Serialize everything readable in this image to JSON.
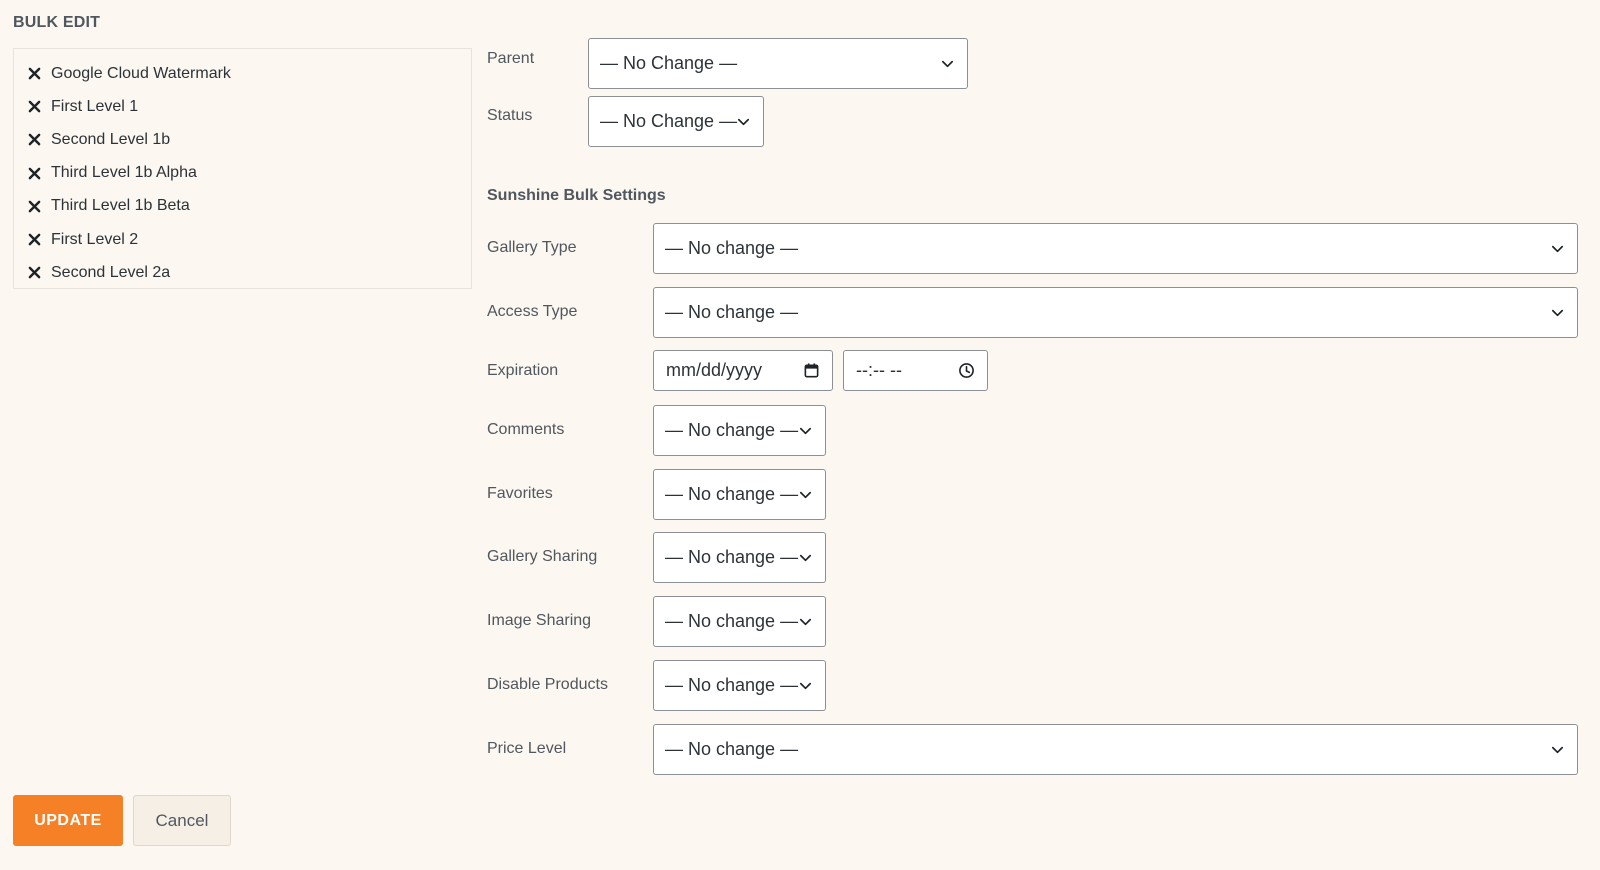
{
  "title": "BULK EDIT",
  "items": [
    {
      "label": "Google Cloud Watermark"
    },
    {
      "label": "First Level 1"
    },
    {
      "label": "Second Level 1b"
    },
    {
      "label": "Third Level 1b Alpha"
    },
    {
      "label": "Third Level 1b Beta"
    },
    {
      "label": "First Level 2"
    },
    {
      "label": "Second Level 2a"
    }
  ],
  "fields": {
    "parent": {
      "label": "Parent",
      "value": "— No Change —"
    },
    "status": {
      "label": "Status",
      "value": "— No Change —"
    }
  },
  "section_title": "Sunshine Bulk Settings",
  "settings": {
    "gallery_type": {
      "label": "Gallery Type",
      "value": "— No change —"
    },
    "access_type": {
      "label": "Access Type",
      "value": "— No change —"
    },
    "expiration": {
      "label": "Expiration",
      "date_placeholder": "mm/dd/yyyy",
      "time_placeholder": "--:-- --"
    },
    "comments": {
      "label": "Comments",
      "value": "— No change —"
    },
    "favorites": {
      "label": "Favorites",
      "value": "— No change —"
    },
    "gallery_sharing": {
      "label": "Gallery Sharing",
      "value": "— No change —"
    },
    "image_sharing": {
      "label": "Image Sharing",
      "value": "— No change —"
    },
    "disable_products": {
      "label": "Disable Products",
      "value": "— No change —"
    },
    "price_level": {
      "label": "Price Level",
      "value": "— No change —"
    }
  },
  "buttons": {
    "update": "UPDATE",
    "cancel": "Cancel"
  },
  "icons": {
    "remove": "close-icon",
    "dropdown": "chevron-down-icon",
    "date": "calendar-icon",
    "time": "clock-icon"
  },
  "colors": {
    "accent": "#f58025",
    "background": "#fcf7f1"
  }
}
